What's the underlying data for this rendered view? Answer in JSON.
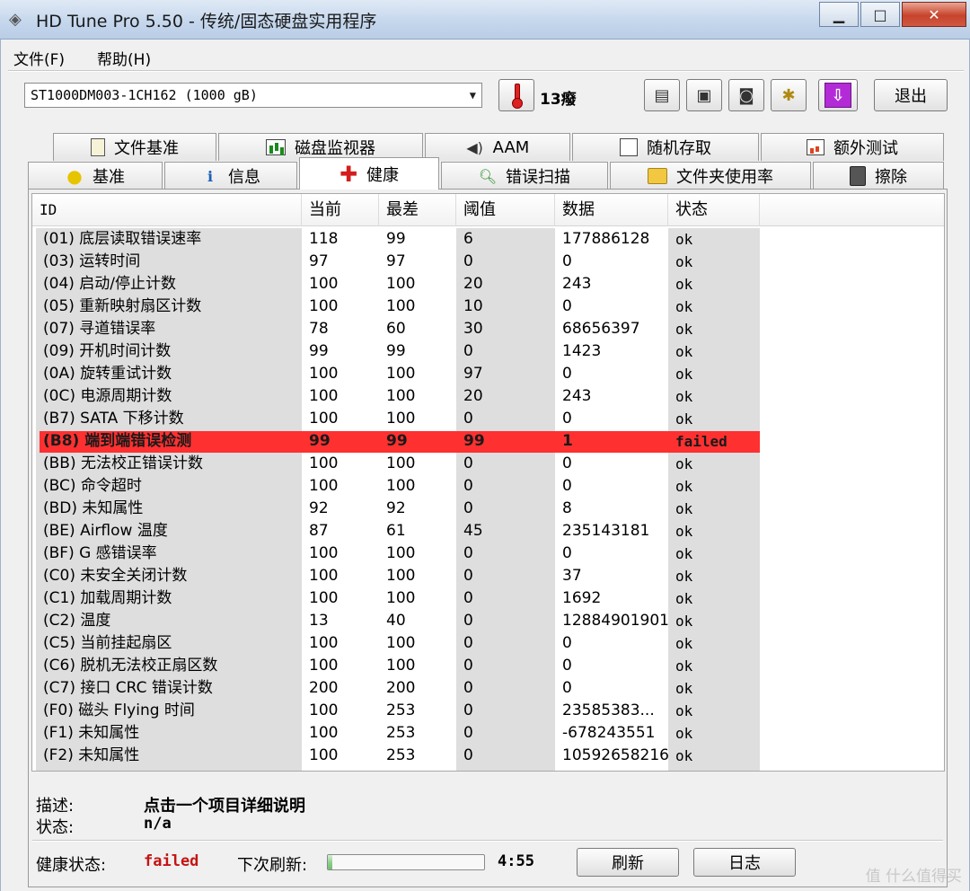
{
  "window": {
    "title": "HD Tune Pro 5.50 - 传统/固态硬盘实用程序",
    "minimize": "▁",
    "maximize": "□",
    "close": "✕"
  },
  "menu": [
    {
      "label": "文件(F)"
    },
    {
      "label": "帮助(H)"
    }
  ],
  "toolbar": {
    "drive": "ST1000DM003-1CH162 (1000 gB)",
    "temperature": "13癈",
    "exit_label": "退出",
    "icons": [
      "copy-text-icon",
      "copy-image-icon",
      "camera-icon",
      "options-icon",
      "save-down-icon"
    ]
  },
  "tabs_top": [
    {
      "label": "文件基准",
      "icon": "file-benchmark-icon"
    },
    {
      "label": "磁盘监视器",
      "icon": "disk-monitor-icon"
    },
    {
      "label": "AAM",
      "icon": "speaker-icon"
    },
    {
      "label": "随机存取",
      "icon": "random-access-icon"
    },
    {
      "label": "额外测试",
      "icon": "extra-tests-icon"
    }
  ],
  "tabs_bottom": [
    {
      "label": "基准",
      "icon": "bulb-icon"
    },
    {
      "label": "信息",
      "icon": "info-icon"
    },
    {
      "label": "健康",
      "icon": "health-cross-icon",
      "active": true
    },
    {
      "label": "错误扫描",
      "icon": "magnifier-icon"
    },
    {
      "label": "文件夹使用率",
      "icon": "folder-icon"
    },
    {
      "label": "擦除",
      "icon": "trash-icon"
    }
  ],
  "table": {
    "columns": [
      "ID",
      "当前",
      "最差",
      "阈值",
      "数据",
      "状态"
    ],
    "rows": [
      [
        "(01) 底层读取错误速率",
        "118",
        "99",
        "6",
        "177886128",
        "ok"
      ],
      [
        "(03) 运转时间",
        "97",
        "97",
        "0",
        "0",
        "ok"
      ],
      [
        "(04) 启动/停止计数",
        "100",
        "100",
        "20",
        "243",
        "ok"
      ],
      [
        "(05) 重新映射扇区计数",
        "100",
        "100",
        "10",
        "0",
        "ok"
      ],
      [
        "(07) 寻道错误率",
        "78",
        "60",
        "30",
        "68656397",
        "ok"
      ],
      [
        "(09) 开机时间计数",
        "99",
        "99",
        "0",
        "1423",
        "ok"
      ],
      [
        "(0A) 旋转重试计数",
        "100",
        "100",
        "97",
        "0",
        "ok"
      ],
      [
        "(0C) 电源周期计数",
        "100",
        "100",
        "20",
        "243",
        "ok"
      ],
      [
        "(B7) SATA 下移计数",
        "100",
        "100",
        "0",
        "0",
        "ok"
      ],
      [
        "(B8) 端到端错误检测",
        "99",
        "99",
        "99",
        "1",
        "failed"
      ],
      [
        "(BB) 无法校正错误计数",
        "100",
        "100",
        "0",
        "0",
        "ok"
      ],
      [
        "(BC) 命令超时",
        "100",
        "100",
        "0",
        "0",
        "ok"
      ],
      [
        "(BD) 未知属性",
        "92",
        "92",
        "0",
        "8",
        "ok"
      ],
      [
        "(BE) Airflow 温度",
        "87",
        "61",
        "45",
        "235143181",
        "ok"
      ],
      [
        "(BF) G 感错误率",
        "100",
        "100",
        "0",
        "0",
        "ok"
      ],
      [
        "(C0) 未安全关闭计数",
        "100",
        "100",
        "0",
        "37",
        "ok"
      ],
      [
        "(C1) 加载周期计数",
        "100",
        "100",
        "0",
        "1692",
        "ok"
      ],
      [
        "(C2) 温度",
        "13",
        "40",
        "0",
        "12884901901",
        "ok"
      ],
      [
        "(C5) 当前挂起扇区",
        "100",
        "100",
        "0",
        "0",
        "ok"
      ],
      [
        "(C6) 脱机无法校正扇区数",
        "100",
        "100",
        "0",
        "0",
        "ok"
      ],
      [
        "(C7) 接口 CRC 错误计数",
        "200",
        "200",
        "0",
        "0",
        "ok"
      ],
      [
        "(F0) 磁头 Flying 时间",
        "100",
        "253",
        "0",
        "23585383...",
        "ok"
      ],
      [
        "(F1) 未知属性",
        "100",
        "253",
        "0",
        "-678243551",
        "ok"
      ],
      [
        "(F2) 未知属性",
        "100",
        "253",
        "0",
        "10592658216",
        "ok"
      ]
    ],
    "failed_row_color": "#ff3030"
  },
  "description": {
    "desc_label": "描述:",
    "desc_value": "点击一个项目详细说明",
    "status_label": "状态:",
    "status_value": "n/a"
  },
  "footer": {
    "health_label": "健康状态:",
    "health_value": "failed",
    "health_color": "#c41414",
    "next_refresh_label": "下次刷新:",
    "refresh_progress": 0.03,
    "countdown": "4:55",
    "refresh_button": "刷新",
    "log_button": "日志"
  },
  "watermark": "值 什么值得买"
}
